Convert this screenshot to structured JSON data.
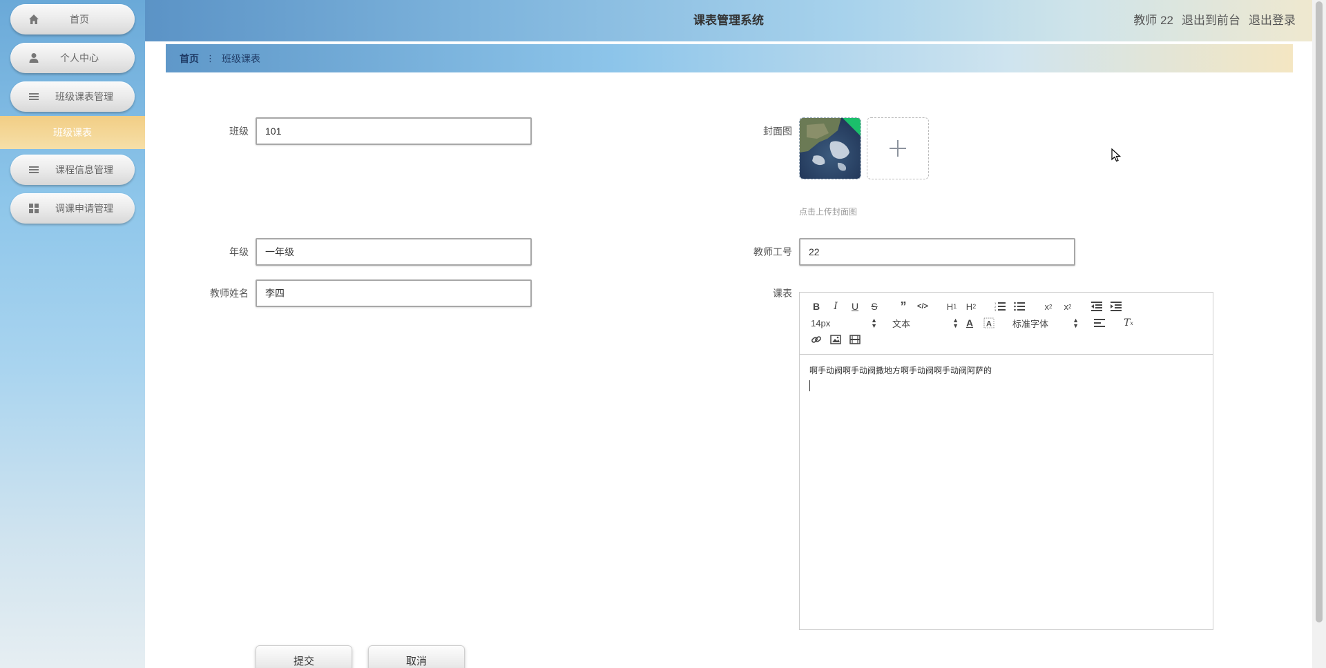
{
  "app": {
    "title": "课表管理系统"
  },
  "header": {
    "user": "教师 22",
    "back_to_front": "退出到前台",
    "logout": "退出登录"
  },
  "sidebar": {
    "items": [
      {
        "label": "首页",
        "icon": "home-icon"
      },
      {
        "label": "个人中心",
        "icon": "user-icon"
      },
      {
        "label": "班级课表管理",
        "icon": "list-icon"
      },
      {
        "label": "课程信息管理",
        "icon": "list-icon"
      },
      {
        "label": "调课申请管理",
        "icon": "grid-icon"
      }
    ],
    "active_sub_item": "班级课表"
  },
  "breadcrumb": {
    "home": "首页",
    "current": "班级课表"
  },
  "form": {
    "class": {
      "label": "班级",
      "value": "101"
    },
    "cover": {
      "label": "封面图",
      "hint": "点击上传封面图"
    },
    "grade": {
      "label": "年级",
      "value": "一年级"
    },
    "teacher_id": {
      "label": "教师工号",
      "value": "22"
    },
    "teacher_name": {
      "label": "教师姓名",
      "value": "李四"
    },
    "schedule": {
      "label": "课表",
      "content": "啊手动阀啊手动阀撒地方啊手动阀啊手动阀阿萨的",
      "font_size": "14px",
      "paragraph": "文本",
      "font_family": "标准字体"
    },
    "submit_label": "提交",
    "cancel_label": "取消"
  },
  "colors": {
    "active_menu": "#f2ce85",
    "header_start": "#5b93c6",
    "header_end": "#efe8cf"
  }
}
